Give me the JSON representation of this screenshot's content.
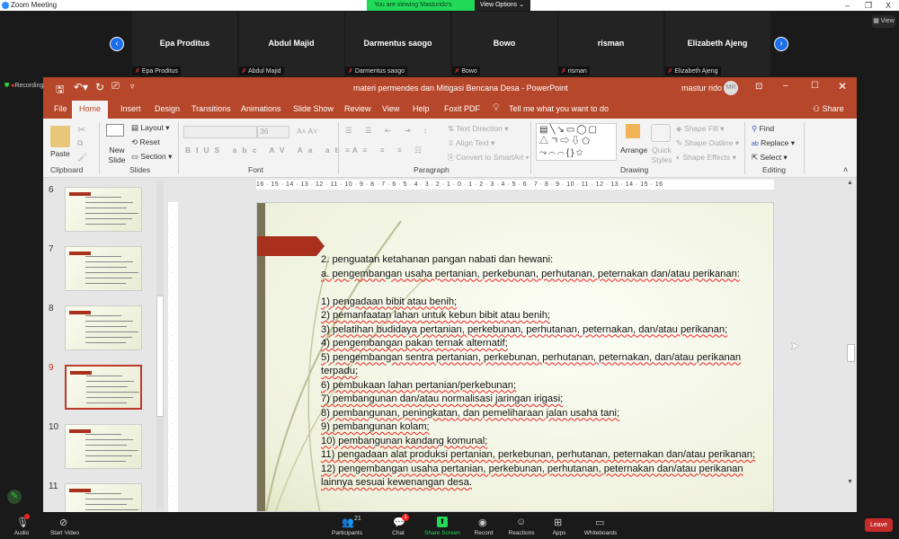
{
  "zoom": {
    "title": "Zoom Meeting",
    "viewing_banner": "You are viewing Masturido's screen",
    "view_options": "View Options",
    "view_button": "View",
    "recording": "Recording",
    "participants": [
      {
        "name": "Epa Proditus"
      },
      {
        "name": "Abdul Majid"
      },
      {
        "name": "Darmentus saogo"
      },
      {
        "name": "Bowo"
      },
      {
        "name": "risman"
      },
      {
        "name": "Elizabeth Ajeng"
      }
    ],
    "toolbar": {
      "audio": "Audio",
      "video": "Start Video",
      "participants": "Participants",
      "participants_count": "21",
      "chat": "Chat",
      "chat_badge": "1",
      "share": "Share Screen",
      "record": "Record",
      "reactions": "Reactions",
      "apps": "Apps",
      "whiteboards": "Whiteboards",
      "leave": "Leave"
    }
  },
  "ppt": {
    "title": "materi permendes dan Mitigasi Bencana Desa  -  PowerPoint",
    "user": "mastur rido",
    "avatar": "MR",
    "tabs": [
      "File",
      "Home",
      "Insert",
      "Design",
      "Transitions",
      "Animations",
      "Slide Show",
      "Review",
      "View",
      "Help",
      "Foxit PDF"
    ],
    "tell_me": "Tell me what you want to do",
    "share": "Share",
    "ribbon": {
      "paste": "Paste",
      "clipboard": "Clipboard",
      "new_slide": "New Slide",
      "layout": "Layout",
      "reset": "Reset",
      "section": "Section",
      "slides": "Slides",
      "font_size": "36",
      "font": "Font",
      "paragraph": "Paragraph",
      "text_direction": "Text Direction",
      "align_text": "Align Text",
      "convert_smartart": "Convert to SmartArt",
      "arrange": "Arrange",
      "quick_styles": "Quick Styles",
      "shape_fill": "Shape Fill",
      "shape_outline": "Shape Outline",
      "shape_effects": "Shape Effects",
      "drawing": "Drawing",
      "find": "Find",
      "replace": "Replace",
      "select": "Select",
      "editing": "Editing"
    },
    "thumbnails": [
      "6",
      "7",
      "8",
      "9",
      "10",
      "11"
    ],
    "ruler": "16 · 15 · 14 · 13 · 12 · 11 · 10 · 9 · 8 · 7 · 6 · 5 · 4 · 3 · 2 · 1 · 0 · 1 · 2 · 3 · 4 · 5 · 6 · 7 · 8 · 9 · 10 · 11 · 12 · 13 · 14 · 15 · 16",
    "slide_lines": [
      "2. penguatan ketahanan pangan nabati dan hewani:",
      "a. pengembangan usaha pertanian, perkebunan, perhutanan, peternakan dan/atau perikanan:",
      "",
      "1) pengadaan bibit atau benih;",
      "2) pemanfaatan lahan untuk kebun bibit atau benih;",
      "3) pelatihan budidaya pertanian, perkebunan, perhutanan, peternakan, dan/atau perikanan;",
      "4) pengembangan pakan ternak alternatif;",
      "5) pengembangan sentra pertanian, perkebunan, perhutanan, peternakan, dan/atau perikanan terpadu;",
      "6) pembukaan lahan pertanian/perkebunan;",
      "7) pembangunan dan/atau normalisasi jaringan irigasi;",
      "8) pembangunan, peningkatan, dan pemeliharaan jalan usaha tani;",
      "9) pembangunan kolam;",
      "10) pembangunan kandang komunal;",
      "11) pengadaan alat produksi pertanian, perkebunan, perhutanan, peternakan dan/atau perikanan;",
      "12) pengembangan usaha pertanian, perkebunan, perhutanan, peternakan dan/atau perikanan lainnya sesuai kewenangan desa."
    ],
    "selected_slide": "9"
  },
  "colors": {
    "ppt_accent": "#b7472a",
    "zoom_blue": "#2d8cff",
    "zoom_green": "#23d959",
    "leave": "#c52b2b"
  }
}
